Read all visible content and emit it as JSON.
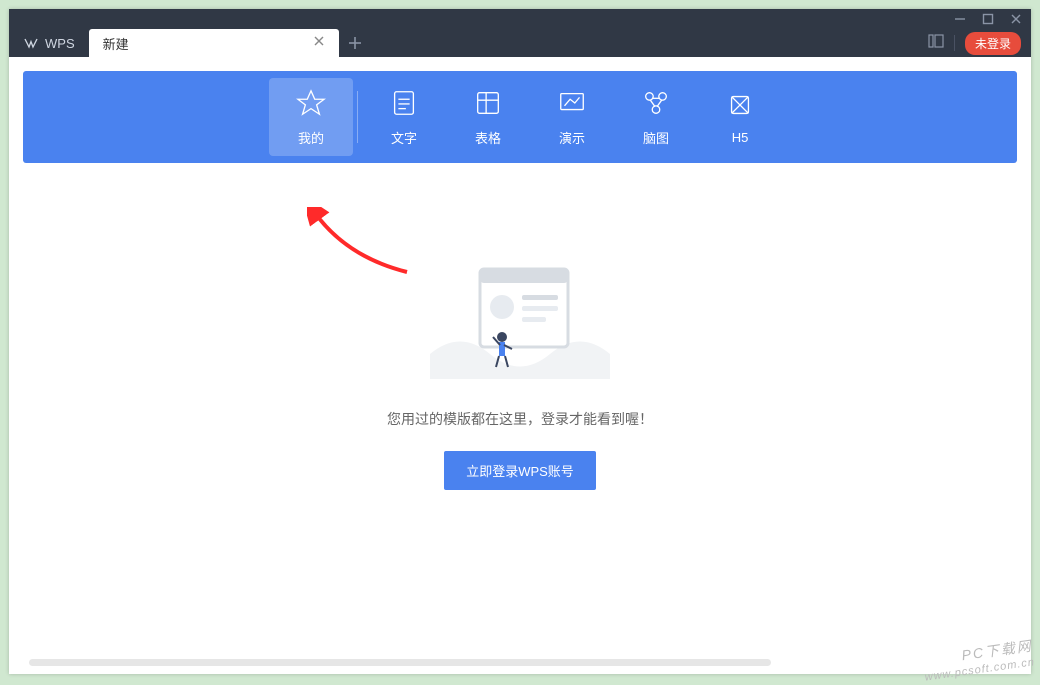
{
  "app": {
    "name": "WPS"
  },
  "tabs": {
    "active_title": "新建"
  },
  "login_status": "未登录",
  "categories": [
    {
      "label": "我的"
    },
    {
      "label": "文字"
    },
    {
      "label": "表格"
    },
    {
      "label": "演示"
    },
    {
      "label": "脑图"
    },
    {
      "label": "H5"
    }
  ],
  "empty": {
    "message": "您用过的模版都在这里，登录才能看到喔！",
    "login_button": "立即登录WPS账号"
  },
  "watermark": {
    "line1": "PC下载网",
    "line2": "www.pcsoft.com.cn"
  }
}
